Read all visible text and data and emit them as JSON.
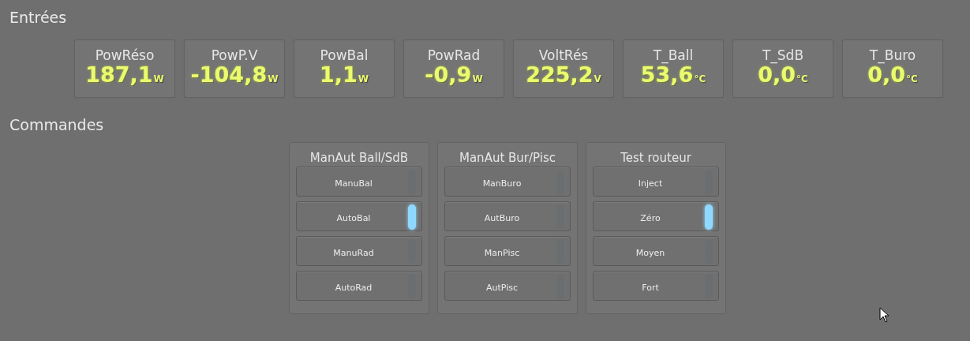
{
  "sections": [
    {
      "title": "Entrées"
    },
    {
      "title": "Commandes"
    }
  ],
  "sensors": [
    {
      "label": "PowRéso",
      "value": "187,1",
      "unit": "W"
    },
    {
      "label": "PowP.V",
      "value": "-104,8",
      "unit": "W"
    },
    {
      "label": "PowBal",
      "value": "1,1",
      "unit": "W"
    },
    {
      "label": "PowRad",
      "value": "-0,9",
      "unit": "W"
    },
    {
      "label": "VoltRés",
      "value": "225,2",
      "unit": "V"
    },
    {
      "label": "T_Ball",
      "value": "53,6",
      "unit": "°C"
    },
    {
      "label": "T_SdB",
      "value": "0,0",
      "unit": "°C"
    },
    {
      "label": "T_Buro",
      "value": "0,0",
      "unit": "°C"
    }
  ],
  "groups": [
    {
      "title": "ManAut Ball/SdB",
      "buttons": [
        {
          "label": "ManuBal",
          "on": false
        },
        {
          "label": "AutoBal",
          "on": true
        },
        {
          "label": "ManuRad",
          "on": false
        },
        {
          "label": "AutoRad",
          "on": false
        }
      ]
    },
    {
      "title": "ManAut Bur/Pisc",
      "buttons": [
        {
          "label": "ManBuro",
          "on": false
        },
        {
          "label": "AutBuro",
          "on": false
        },
        {
          "label": "ManPisc",
          "on": false
        },
        {
          "label": "AutPisc",
          "on": false
        }
      ]
    },
    {
      "title": "Test routeur",
      "buttons": [
        {
          "label": "Inject",
          "on": false
        },
        {
          "label": "Zéro",
          "on": true
        },
        {
          "label": "Moyen",
          "on": false
        },
        {
          "label": "Fort",
          "on": false
        }
      ]
    }
  ]
}
